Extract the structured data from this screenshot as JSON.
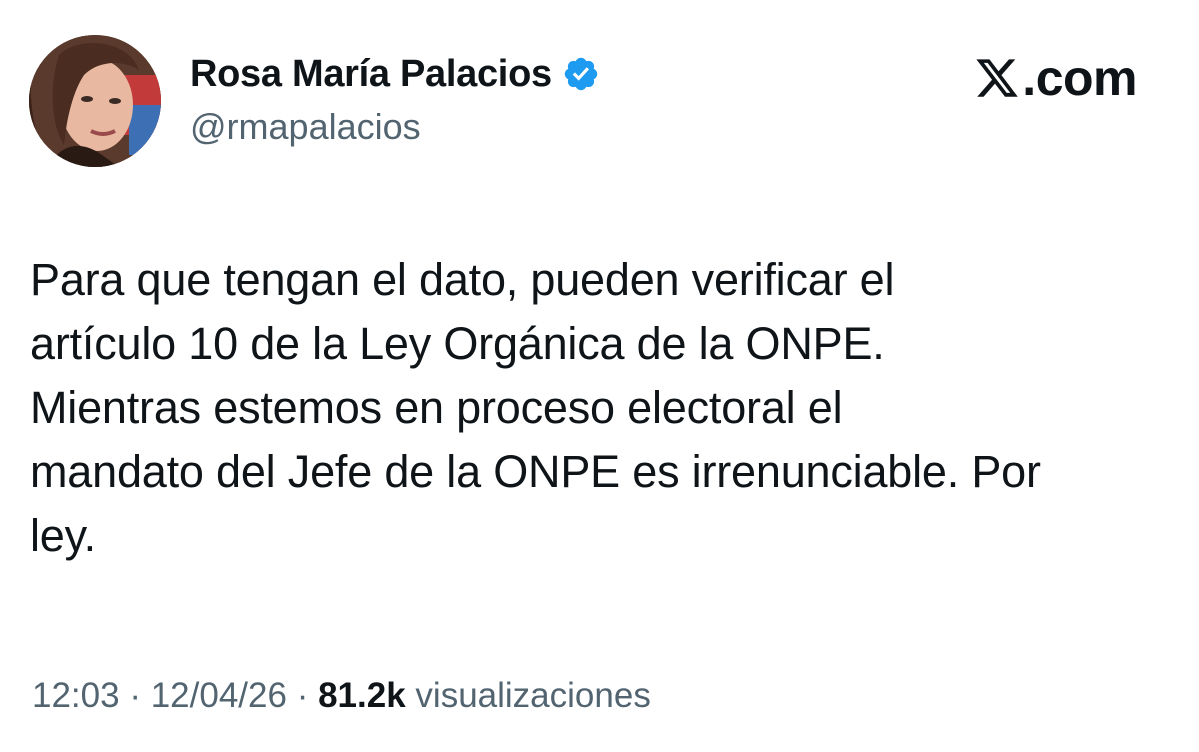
{
  "author": {
    "display_name": "Rosa María Palacios",
    "handle": "@rmapalacios",
    "verified_icon": "verified-badge-icon",
    "avatar": "profile-photo"
  },
  "source": {
    "logo_icon": "x-logo-icon",
    "text": ".com"
  },
  "tweet": {
    "lines": [
      "Para que tengan el dato, pueden verificar el",
      "artículo 10 de la Ley Orgánica de la ONPE.",
      "Mientras estemos en proceso electoral el",
      "mandato del Jefe de la ONPE es irrenunciable. Por",
      "ley."
    ]
  },
  "meta": {
    "time": "12:03",
    "separator": "·",
    "date": "12/04/26",
    "views_count": "81.2k",
    "views_label": "visualizaciones"
  },
  "colors": {
    "text_primary": "#0f1419",
    "text_secondary": "#536471",
    "verified_blue": "#1d9bf0",
    "background": "#ffffff"
  }
}
